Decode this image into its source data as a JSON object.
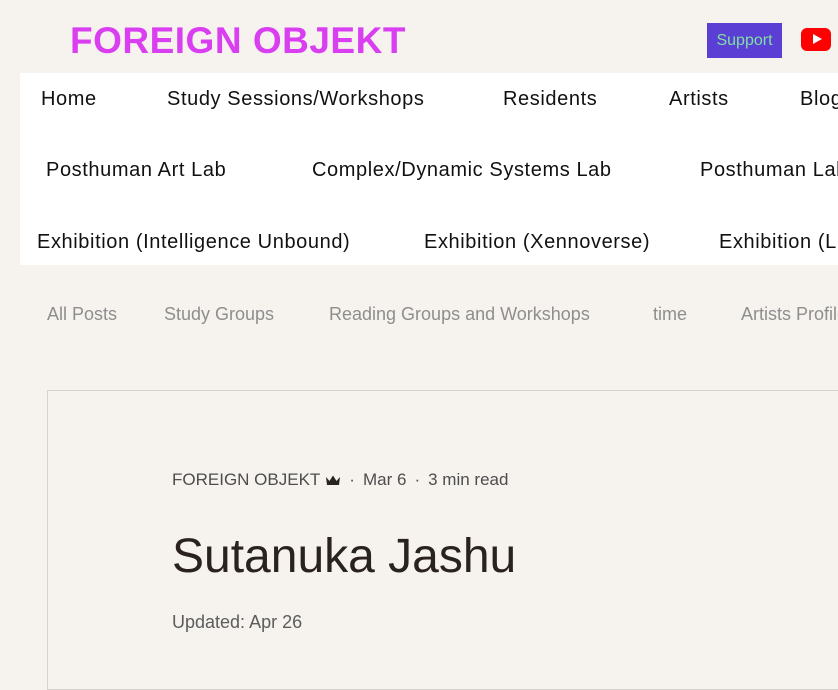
{
  "header": {
    "site_title": "FOREIGN OBJEKT",
    "support_label": "Support",
    "youtube_icon": "youtube-icon",
    "brand_color": "#d93ff0",
    "support_bg": "#5b3fd4",
    "support_text_color": "#7fe0a2"
  },
  "nav": {
    "row1": [
      "Home",
      "Study Sessions/Workshops",
      "Residents",
      "Artists",
      "Blog"
    ],
    "row2": [
      "Posthuman Art Lab",
      "Complex/Dynamic Systems Lab",
      "Posthuman Lab"
    ],
    "row3": [
      "Exhibition (Intelligence Unbound)",
      "Exhibition (Xennoverse)",
      "Exhibition (L"
    ]
  },
  "filters": [
    "All Posts",
    "Study Groups",
    "Reading Groups and Workshops",
    "time",
    "Artists Profile"
  ],
  "post": {
    "author": "FOREIGN OBJEKT",
    "author_badge_icon": "crown-icon",
    "date": "Mar 6",
    "read_time": "3 min read",
    "title": "Sutanuka Jashu",
    "updated": "Updated: Apr 26"
  }
}
